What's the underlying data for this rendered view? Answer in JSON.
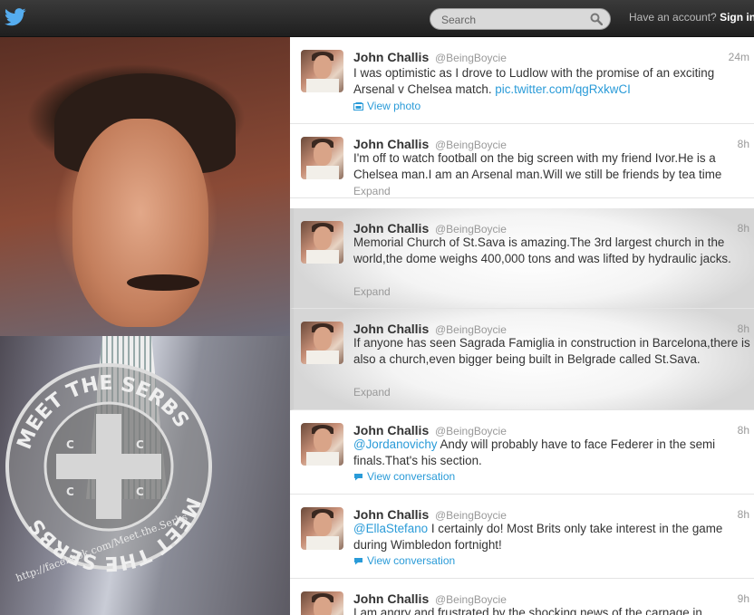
{
  "header": {
    "search_placeholder": "Search",
    "account_prompt": "Have an account?",
    "sign_in_label": "Sign in"
  },
  "photo": {
    "seal_top_text": "MEET THE SERBS",
    "seal_bottom_text": "MEET THE SERBS",
    "seal_url": "http://facebook.com/Meet.the.Serbs"
  },
  "tweets": [
    {
      "name": "John Challis",
      "handle": "@BeingBoycie",
      "time": "24m",
      "text": "I was optimistic as I drove to Ludlow with the promise of an exciting Arsenal v Chelsea match. ",
      "link": "pic.twitter.com/qgRxkwCI",
      "action": "View photo"
    },
    {
      "name": "John Challis",
      "handle": "@BeingBoycie",
      "time": "8h",
      "text": "I'm off to watch football on the big screen with my friend Ivor.He is a Chelsea man.I am an Arsenal man.Will we still be friends by tea time",
      "action": "Expand"
    },
    {
      "name": "John Challis",
      "handle": "@BeingBoycie",
      "time": "8h",
      "text": "Memorial Church of St.Sava is amazing.The 3rd largest church in the world,the dome weighs 400,000 tons and was lifted by hydraulic jacks.",
      "action": "Expand"
    },
    {
      "name": "John Challis",
      "handle": "@BeingBoycie",
      "time": "8h",
      "text": "If anyone has seen Sagrada Famiglia in construction in Barcelona,there is also a church,even bigger being built in Belgrade called St.Sava.",
      "action": "Expand"
    },
    {
      "name": "John Challis",
      "handle": "@BeingBoycie",
      "time": "8h",
      "mention": "@Jordanovichy",
      "text": " Andy will probably have to face Federer in the semi finals.That's his section.",
      "action": "View conversation"
    },
    {
      "name": "John Challis",
      "handle": "@BeingBoycie",
      "time": "8h",
      "mention": "@EllaStefano",
      "text": " I certainly do! Most Brits only take interest in the game during Wimbledon fortnight!",
      "action": "View conversation"
    },
    {
      "name": "John Challis",
      "handle": "@BeingBoycie",
      "time": "9h",
      "text": "I am angry and frustrated by the shocking news of the carnage in"
    }
  ],
  "icons": {
    "logo": "twitter-bird-icon",
    "search": "search-icon",
    "photo": "photo-icon",
    "conversation": "conversation-icon"
  },
  "colors": {
    "link": "#2a9bd8",
    "topbar": "#2b2b2b",
    "twitter_blue": "#55acee"
  }
}
